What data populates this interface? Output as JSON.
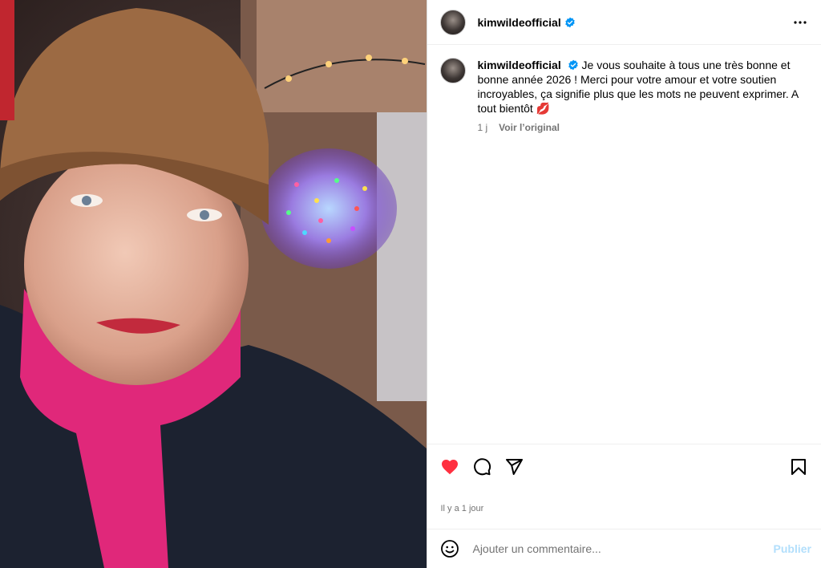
{
  "post": {
    "author": "kimwildeofficial",
    "header": {
      "username": "kimwildeofficial",
      "more_icon": "more-horizontal-icon"
    },
    "caption": {
      "username": "kimwildeofficial",
      "text": "Je vous souhaite à tous une très bonne et bonne année 2026 ! Merci pour votre amour et votre soutien incroyables, ça signifie plus que les mots ne peuvent exprimer. A tout bientôt 💋",
      "age": "1 j",
      "see_original": "Voir l’original"
    },
    "actions": {
      "like": "heart-filled-icon",
      "comment": "comment-icon",
      "share": "share-icon",
      "save": "bookmark-icon"
    },
    "date_text": "Il y a 1 jour",
    "comment": {
      "placeholder": "Ajouter un commentaire...",
      "publish_label": "Publier",
      "emoji_icon": "emoji-icon"
    }
  },
  "colors": {
    "like_red": "#ff3040",
    "verified_blue": "#0095f6",
    "publish_disabled": "#b2dffc",
    "scarf_pink": "#e0287a",
    "hat_brown": "#9c6a43"
  }
}
